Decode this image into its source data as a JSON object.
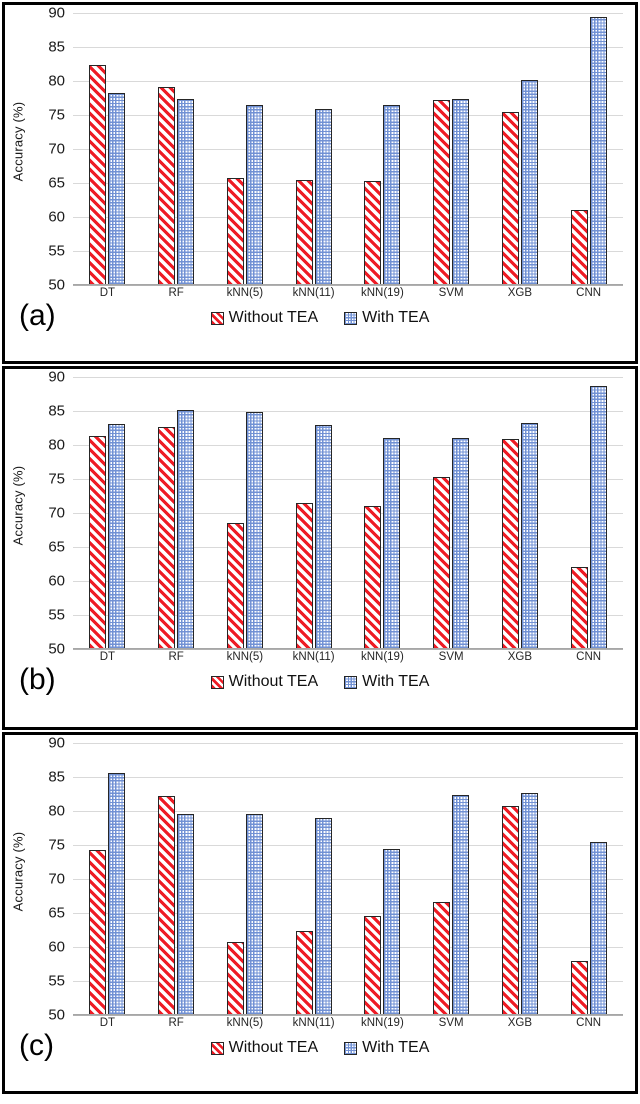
{
  "figure": {
    "panels": [
      "a",
      "b",
      "c"
    ],
    "colors": {
      "without_tea": "#ee1c25",
      "with_tea": "#7191d4",
      "bar_outline": "#262626",
      "gridline": "#d9d9d9",
      "panel_border": "#000000"
    }
  },
  "panel_a": {
    "tag": "(a)",
    "legend": [
      {
        "label": "Without TEA",
        "swatch": "red-diagonal-hatch-swatch"
      },
      {
        "label": "With TEA",
        "swatch": "blue-dotted-swatch"
      }
    ]
  },
  "panel_b": {
    "tag": "(b)",
    "legend": [
      {
        "label": "Without TEA",
        "swatch": "red-diagonal-hatch-swatch"
      },
      {
        "label": "With TEA",
        "swatch": "blue-dotted-swatch"
      }
    ]
  },
  "panel_c": {
    "tag": "(c)",
    "legend": [
      {
        "label": "Without TEA",
        "swatch": "red-diagonal-hatch-swatch"
      },
      {
        "label": "With TEA",
        "swatch": "blue-dotted-swatch"
      }
    ]
  },
  "chart_data": [
    {
      "id": "a",
      "type": "bar",
      "title": "",
      "panel_label": "(a)",
      "xlabel": "",
      "ylabel": "Accuracy (%)",
      "ylim": [
        50,
        90
      ],
      "yticks": [
        50,
        55,
        60,
        65,
        70,
        75,
        80,
        85,
        90
      ],
      "ytick_labels": [
        "50",
        "55",
        "60",
        "65",
        "70",
        "75",
        "80",
        "85",
        "90"
      ],
      "grid": "horizontal",
      "legend_position": "bottom-center",
      "categories": [
        "DT",
        "RF",
        "kNN(5)",
        "kNN(11)",
        "kNN(19)",
        "SVM",
        "XGB",
        "CNN"
      ],
      "series": [
        {
          "name": "Without TEA",
          "values": [
            82.4,
            79.1,
            65.7,
            65.5,
            65.3,
            77.2,
            75.5,
            61.1
          ]
        },
        {
          "name": "With TEA",
          "values": [
            78.2,
            77.3,
            76.4,
            75.9,
            76.5,
            77.3,
            80.2,
            89.4
          ]
        }
      ]
    },
    {
      "id": "b",
      "type": "bar",
      "title": "",
      "panel_label": "(b)",
      "xlabel": "",
      "ylabel": "Accuracy (%)",
      "ylim": [
        50,
        90
      ],
      "yticks": [
        50,
        55,
        60,
        65,
        70,
        75,
        80,
        85,
        90
      ],
      "ytick_labels": [
        "50",
        "55",
        "60",
        "65",
        "70",
        "75",
        "80",
        "85",
        "90"
      ],
      "grid": "horizontal",
      "legend_position": "bottom-center",
      "categories": [
        "DT",
        "RF",
        "kNN(5)",
        "kNN(11)",
        "kNN(19)",
        "SVM",
        "XGB",
        "CNN"
      ],
      "series": [
        {
          "name": "Without TEA",
          "values": [
            81.3,
            82.6,
            68.6,
            71.4,
            71.1,
            75.3,
            80.9,
            62.1
          ]
        },
        {
          "name": "With TEA",
          "values": [
            83.1,
            85.1,
            84.8,
            82.9,
            81.1,
            81.0,
            83.2,
            88.7
          ]
        }
      ]
    },
    {
      "id": "c",
      "type": "bar",
      "title": "",
      "panel_label": "(c)",
      "xlabel": "",
      "ylabel": "Accuracy (%)",
      "ylim": [
        50,
        90
      ],
      "yticks": [
        50,
        55,
        60,
        65,
        70,
        75,
        80,
        85,
        90
      ],
      "ytick_labels": [
        "50",
        "55",
        "60",
        "65",
        "70",
        "75",
        "80",
        "85",
        "90"
      ],
      "grid": "horizontal",
      "legend_position": "bottom-center",
      "categories": [
        "DT",
        "RF",
        "kNN(5)",
        "kNN(11)",
        "kNN(19)",
        "SVM",
        "XGB",
        "CNN"
      ],
      "series": [
        {
          "name": "Without TEA",
          "values": [
            74.2,
            82.2,
            60.7,
            62.4,
            64.6,
            66.6,
            80.8,
            58.0
          ]
        },
        {
          "name": "With TEA",
          "values": [
            85.6,
            79.6,
            79.5,
            78.9,
            74.4,
            82.3,
            82.6,
            75.5
          ]
        }
      ]
    }
  ]
}
